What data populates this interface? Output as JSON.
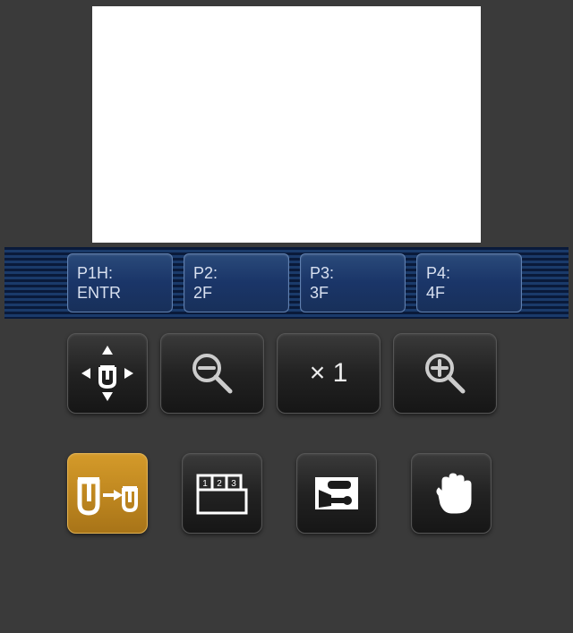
{
  "floors": [
    {
      "line1": "P1H:",
      "line2": "ENTR"
    },
    {
      "line1": "P2:",
      "line2": "2F"
    },
    {
      "line1": "P3:",
      "line2": "3F"
    },
    {
      "line1": "P4:",
      "line2": "4F"
    }
  ],
  "zoom": {
    "label": "× 1"
  },
  "icons": {
    "positioning": "positioning-arrows",
    "zoom_out": "zoom-out",
    "zoom_in": "zoom-in",
    "transfer": "cup-transfer",
    "layout123": "layout-123",
    "brush": "brush-tool",
    "hand": "hand-pan"
  }
}
